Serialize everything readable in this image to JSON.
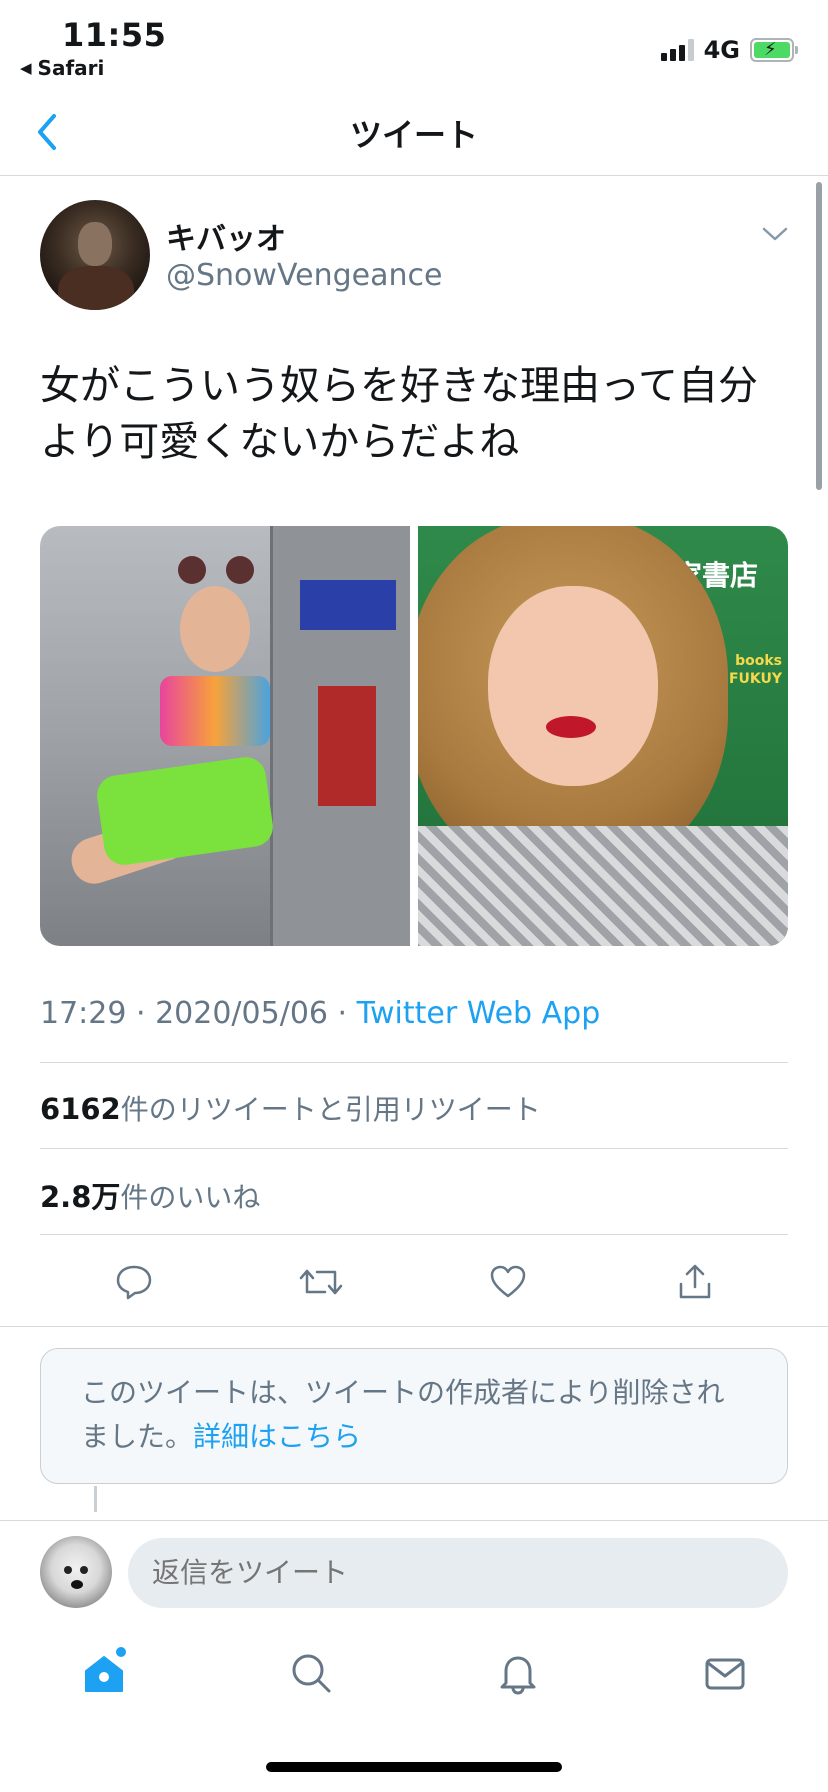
{
  "status_bar": {
    "time": "11:55",
    "back_app": "Safari",
    "network": "4G",
    "battery_level": 1.0,
    "signal_bars": 3
  },
  "navbar": {
    "title": "ツイート",
    "back_icon": "chevron-left-icon"
  },
  "tweet": {
    "author": {
      "display_name": "キバッオ",
      "handle": "@SnowVengeance"
    },
    "text": "女がこういう奴らを好きな理由って自分より可愛くないからだよね",
    "media": {
      "photo_right_sign": "家書店",
      "photo_right_books": "books\nFUKUY"
    },
    "meta": {
      "time": "17:29",
      "separator": " · ",
      "date": "2020/05/06",
      "source": "Twitter Web App"
    },
    "stats": {
      "retweets_count": "6162",
      "retweets_label": "件のリツイートと引用リツイート",
      "likes_count": "2.8万",
      "likes_label": "件のいいね"
    },
    "actions": [
      "reply-icon",
      "retweet-icon",
      "like-icon",
      "share-icon"
    ]
  },
  "notice": {
    "text": "このツイートは、ツイートの作成者により削除されました。",
    "link": "詳細はこちら"
  },
  "reply": {
    "placeholder": "返信をツイート"
  },
  "tabbar": {
    "items": [
      "home-icon",
      "search-icon",
      "notifications-icon",
      "messages-icon"
    ],
    "active": "home-icon"
  },
  "colors": {
    "accent": "#1da1f2",
    "secondary_text": "#657786",
    "primary_text": "#14171a"
  }
}
